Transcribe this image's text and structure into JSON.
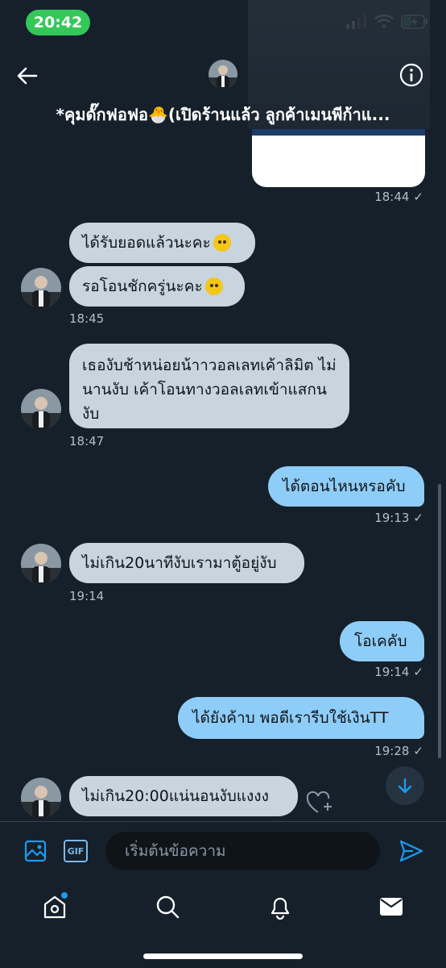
{
  "status": {
    "time": "20:42",
    "icons": [
      "signal-icon",
      "wifi-icon",
      "battery-icon"
    ]
  },
  "header": {
    "title": "*คุมดั๊กฟอฟอ🐣(เปิดร้านแล้ว ลูกค้าเมนพีก้าแ...",
    "back_icon": "arrow-left-icon",
    "info_icon": "info-icon"
  },
  "messages": [
    {
      "id": "m1",
      "dir": "out",
      "kind": "card",
      "time": "18:44"
    },
    {
      "id": "m2",
      "dir": "in",
      "text": "ได้รับยอดแล้วนะคะ",
      "emoji": "smiling-face-with-hearts"
    },
    {
      "id": "m3",
      "dir": "in",
      "text": "รอโอนชักครู่นะคะ",
      "emoji": "pleading-face",
      "time": "18:45"
    },
    {
      "id": "m4",
      "dir": "in",
      "text": "เธองับช้าหน่อยน้าาวอลเลทเค้าลิมิต ไม่นานงับ เค้าโอนทางวอลเลทเข้าแสกนงับ",
      "time": "18:47"
    },
    {
      "id": "m5",
      "dir": "out",
      "text": "ได้ตอนไหนหรอคับ",
      "time": "19:13"
    },
    {
      "id": "m6",
      "dir": "in",
      "text": "ไม่เกิน20นาทีงับเรามาตู้อยู่งับ",
      "time": "19:14"
    },
    {
      "id": "m7",
      "dir": "out",
      "text": "โอเคคับ",
      "time": "19:14"
    },
    {
      "id": "m8",
      "dir": "out",
      "text": "ได้ยังค้าบ พอดีเรารีบใช้เงินTT",
      "time": "19:28"
    },
    {
      "id": "m9",
      "dir": "in",
      "text": "ไม่เกิน20:00แน่นอนงับแงงง"
    }
  ],
  "composer": {
    "placeholder": "เริ่มต้นข้อความ",
    "gif_label": "GIF",
    "icons": [
      "image-icon",
      "gif-icon",
      "send-icon"
    ]
  },
  "nav": {
    "items": [
      "home-icon",
      "search-icon",
      "notifications-icon",
      "messages-icon"
    ],
    "active": "messages-icon"
  },
  "colors": {
    "background": "#15202b",
    "outgoing_bubble": "#8ecdf7",
    "incoming_bubble": "#c8d5de",
    "accent": "#1d9bf0",
    "status_pill": "#34c759"
  }
}
